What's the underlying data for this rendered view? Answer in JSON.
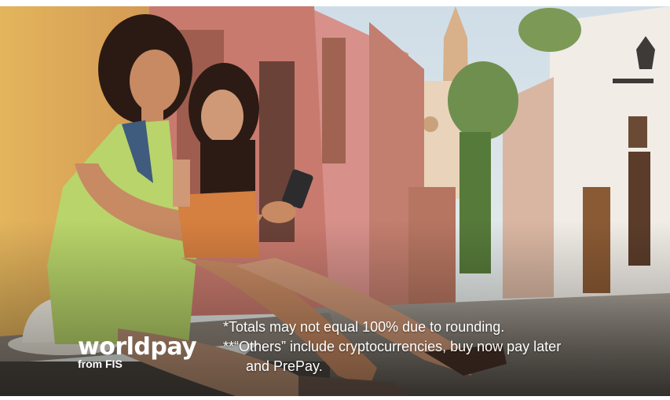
{
  "brand": {
    "name": "worldpay",
    "subline": "from FIS"
  },
  "footnotes": {
    "line1": "*Totals may not equal 100% due to rounding.",
    "line2": "**“Others” include cryptocurrencies, buy now pay later",
    "line3": "and PrePay."
  },
  "colors": {
    "wall": "#e8b75f",
    "street": "#9a9288",
    "sky": "#dfe8ef",
    "dress": "#b8d46a",
    "text": "#ffffff"
  }
}
